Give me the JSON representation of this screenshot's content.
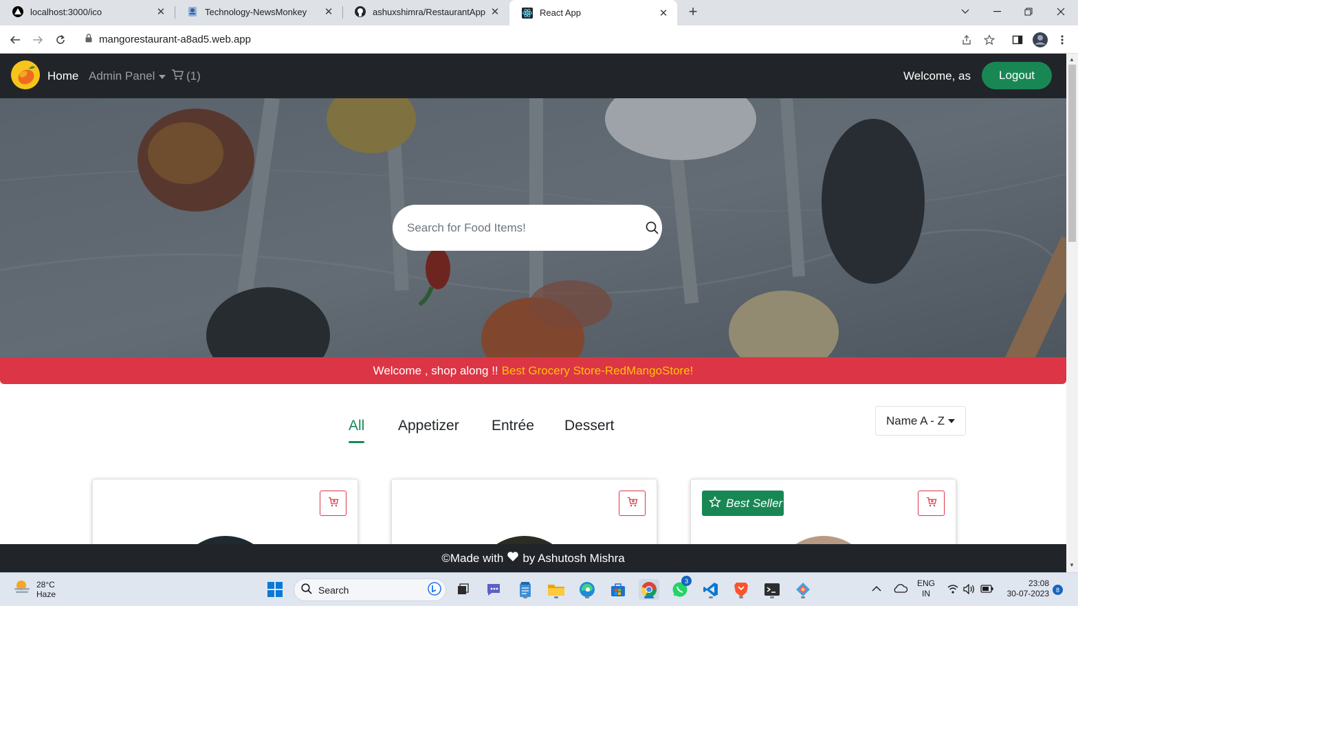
{
  "browser": {
    "tabs": [
      {
        "title": "localhost:3000/ico",
        "icon": "triangle-logo-icon"
      },
      {
        "title": "Technology-NewsMonkey",
        "icon": "news-icon"
      },
      {
        "title": "ashuxshimra/RestaurantApp",
        "icon": "github-icon"
      },
      {
        "title": "React App",
        "icon": "react-icon",
        "active": true
      }
    ],
    "url": "mangorestaurant-a8ad5.web.app"
  },
  "navbar": {
    "home": "Home",
    "admin_panel": "Admin Panel",
    "cart_count": "(1)",
    "welcome": "Welcome, as",
    "logout": "Logout"
  },
  "hero": {
    "search_placeholder": "Search for Food Items!"
  },
  "banner": {
    "text": "Welcome , shop along !!",
    "highlight": "Best Grocery Store-RedMangoStore!"
  },
  "categories": [
    "All",
    "Appetizer",
    "Entrée",
    "Dessert"
  ],
  "active_category": "All",
  "sort": {
    "label": "Name A - Z"
  },
  "cards": [
    {
      "best_seller": false
    },
    {
      "best_seller": false
    },
    {
      "best_seller": true,
      "badge_label": "Best Seller"
    }
  ],
  "footer": {
    "prefix": "©Made with",
    "suffix": "by Ashutosh Mishra"
  },
  "taskbar": {
    "weather_temp": "28°C",
    "weather_desc": "Haze",
    "search_label": "Search",
    "whatsapp_badge": "3",
    "lang_line1": "ENG",
    "lang_line2": "IN",
    "time": "23:08",
    "date": "30-07-2023",
    "notification_count": "8"
  },
  "colors": {
    "navbar": "#212529",
    "success": "#198754",
    "danger": "#dc3545",
    "warning": "#ffc107"
  }
}
